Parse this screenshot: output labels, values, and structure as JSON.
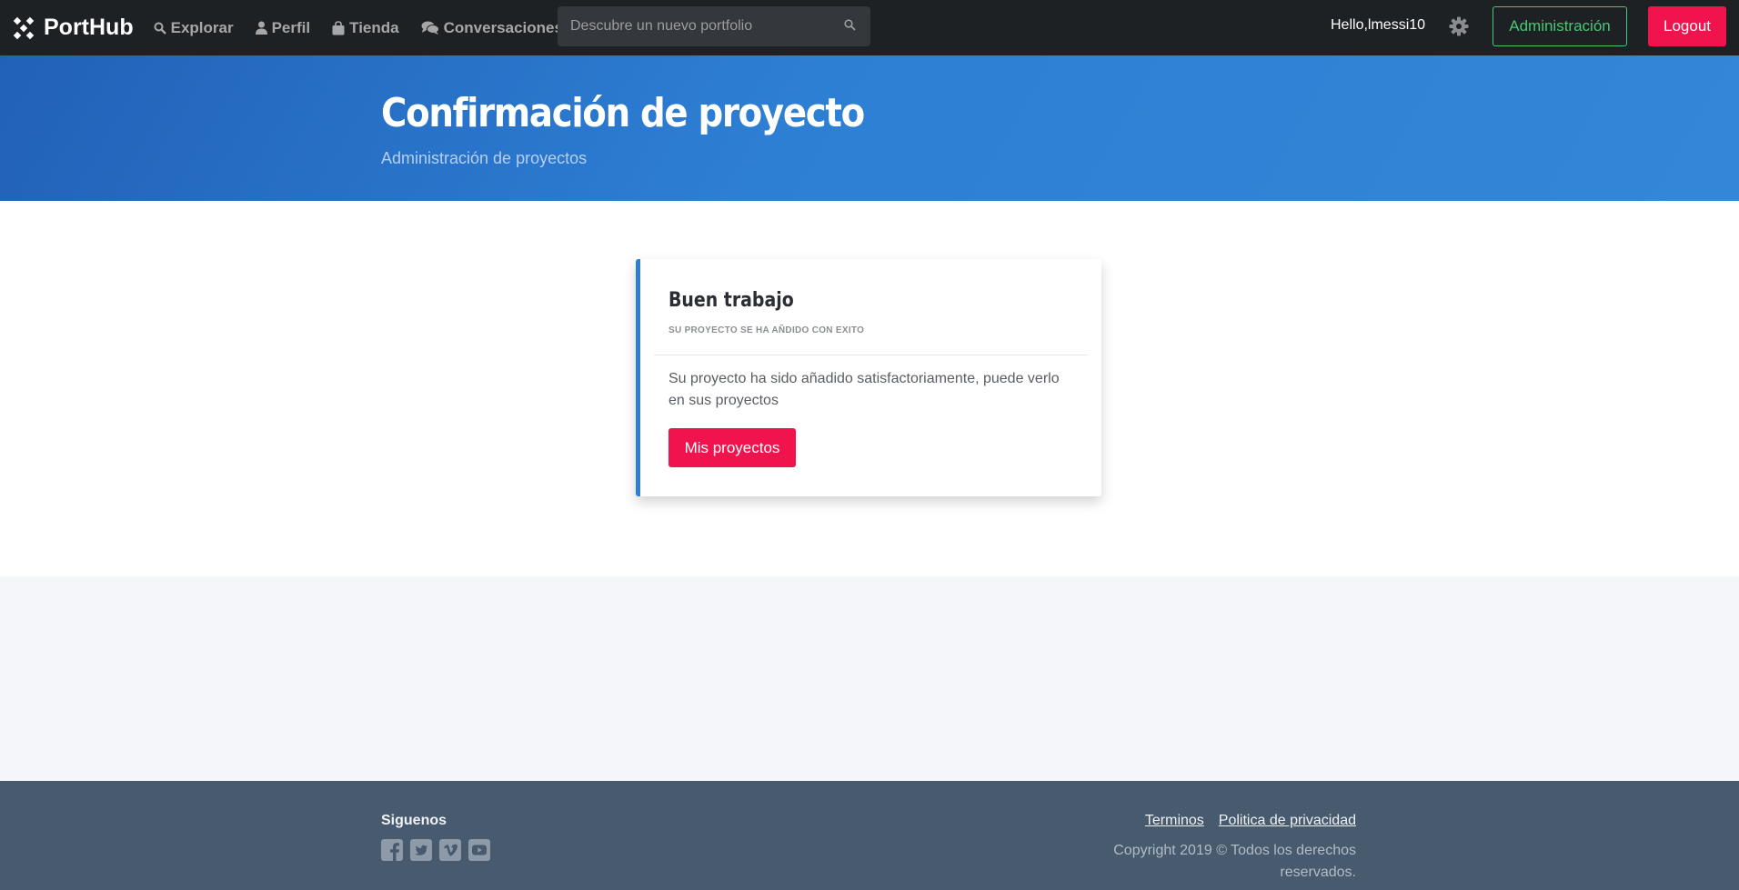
{
  "navbar": {
    "brand": "PortHub",
    "links": [
      {
        "label": "Explorar",
        "icon": "search-icon"
      },
      {
        "label": "Perfil",
        "icon": "user-icon"
      },
      {
        "label": "Tienda",
        "icon": "shopping-bag-icon"
      },
      {
        "label": "Conversaciones",
        "icon": "comments-icon"
      }
    ],
    "search_placeholder": "Descubre un nuevo portfolio",
    "greeting": "Hello,lmessi10",
    "admin_label": "Administración",
    "logout_label": "Logout"
  },
  "hero": {
    "title": "Confirmación de proyecto",
    "subtitle": "Administración de proyectos"
  },
  "card": {
    "title": "Buen trabajo",
    "tagline": "SU PROYECTO SE HA AÑDIDO CON EXITO",
    "body": "Su proyecto ha sido añadido satisfactoriamente, puede verlo en sus proyectos",
    "button_label": "Mis proyectos"
  },
  "footer": {
    "follow_label": "Siguenos",
    "socials": [
      "facebook-icon",
      "twitter-icon",
      "vimeo-icon",
      "youtube-icon"
    ],
    "terms_label": "Terminos",
    "privacy_label": "Politica de privacidad",
    "copyright": "Copyright 2019 © Todos los derechos reservados."
  },
  "colors": {
    "navbar_bg": "#1e2124",
    "hero_blue": "#2d7fd4",
    "accent_red": "#f0134d",
    "admin_green": "#48c774",
    "footer_bg": "#475a6e"
  }
}
